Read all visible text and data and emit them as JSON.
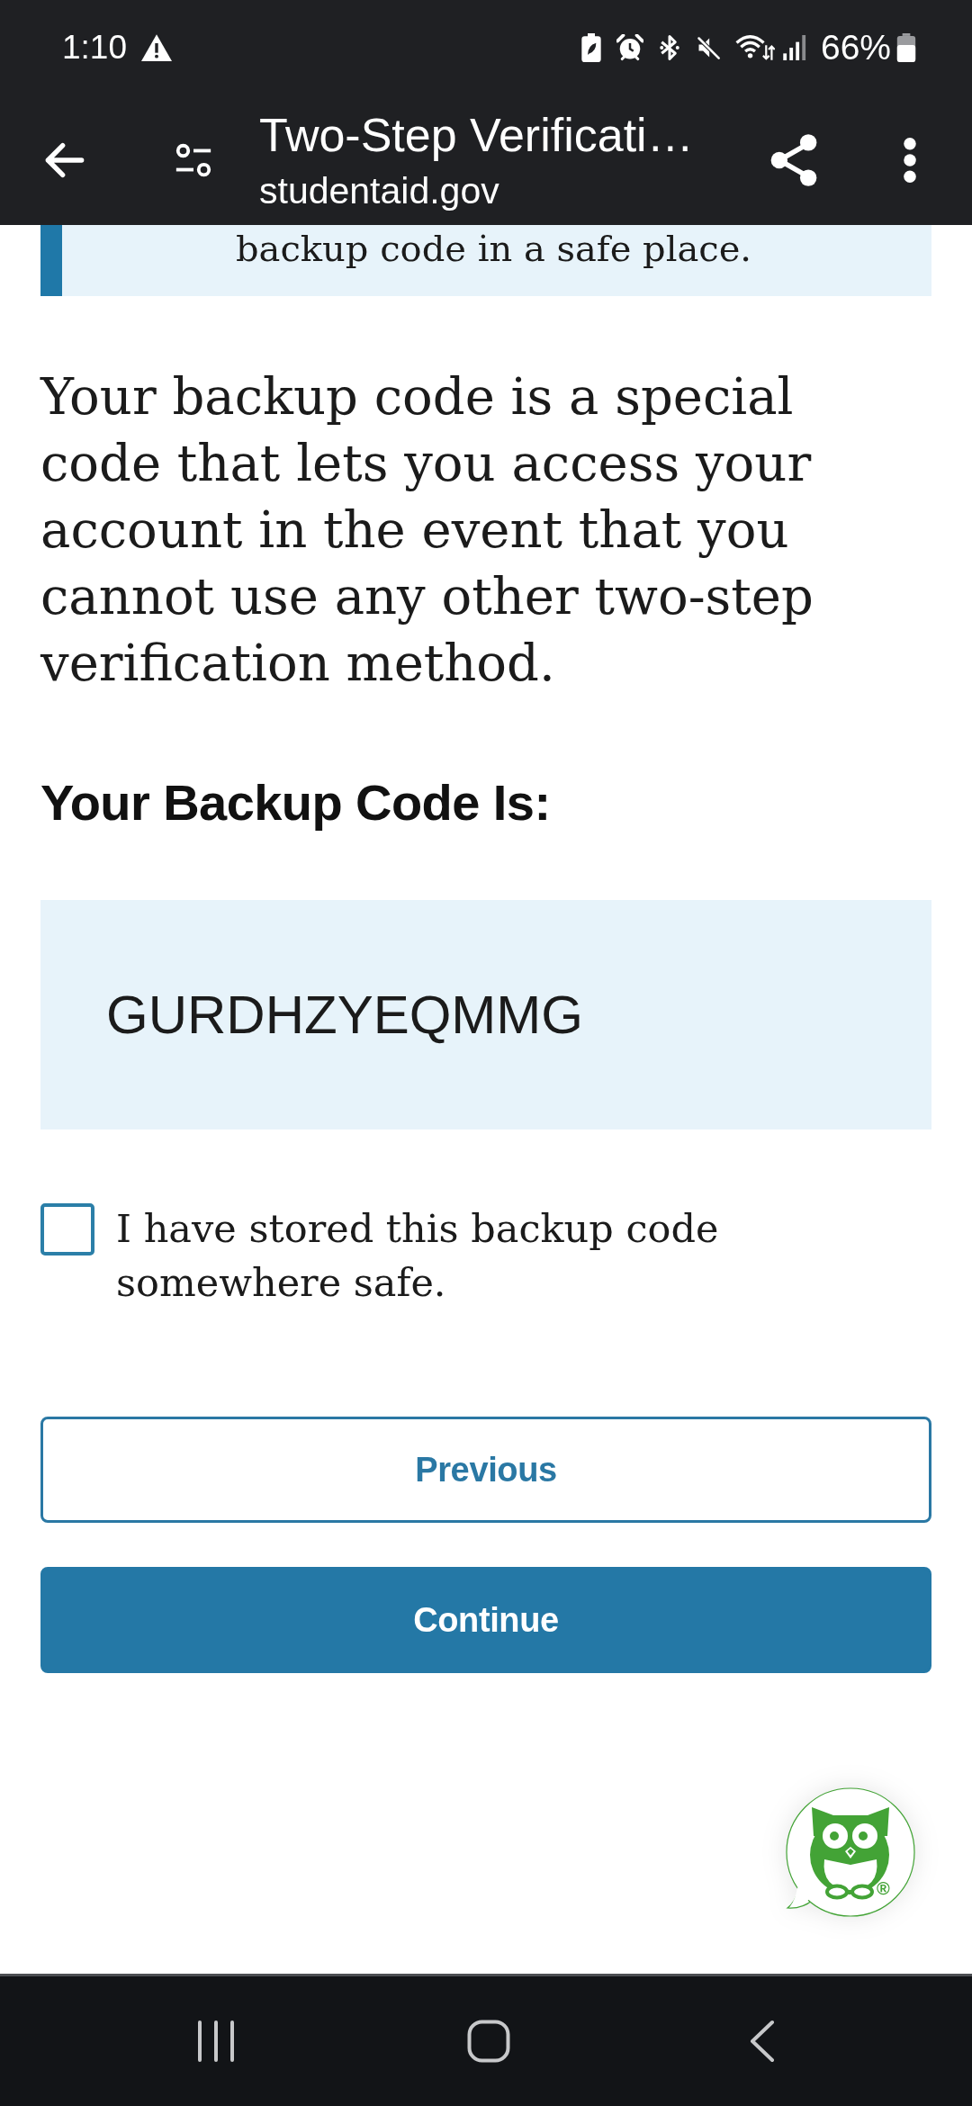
{
  "status_bar": {
    "time": "1:10",
    "battery": "66%"
  },
  "toolbar": {
    "title": "Two-Step Verificati…",
    "url": "studentaid.gov"
  },
  "alert": {
    "text": "backup code in a safe place."
  },
  "intro": "Your backup code is a special code that lets you access your account in the event that you cannot use any other two-step verification method.",
  "heading": "Your Backup Code Is:",
  "backup_code": "GURDHZYEQMMG",
  "consent": {
    "label": "I have stored this backup code somewhere safe.",
    "checked": false
  },
  "buttons": [
    {
      "label": "Previous",
      "kind": "secondary"
    },
    {
      "label": "Continue",
      "kind": "primary"
    }
  ],
  "chat_widget": {
    "mark": "®"
  }
}
